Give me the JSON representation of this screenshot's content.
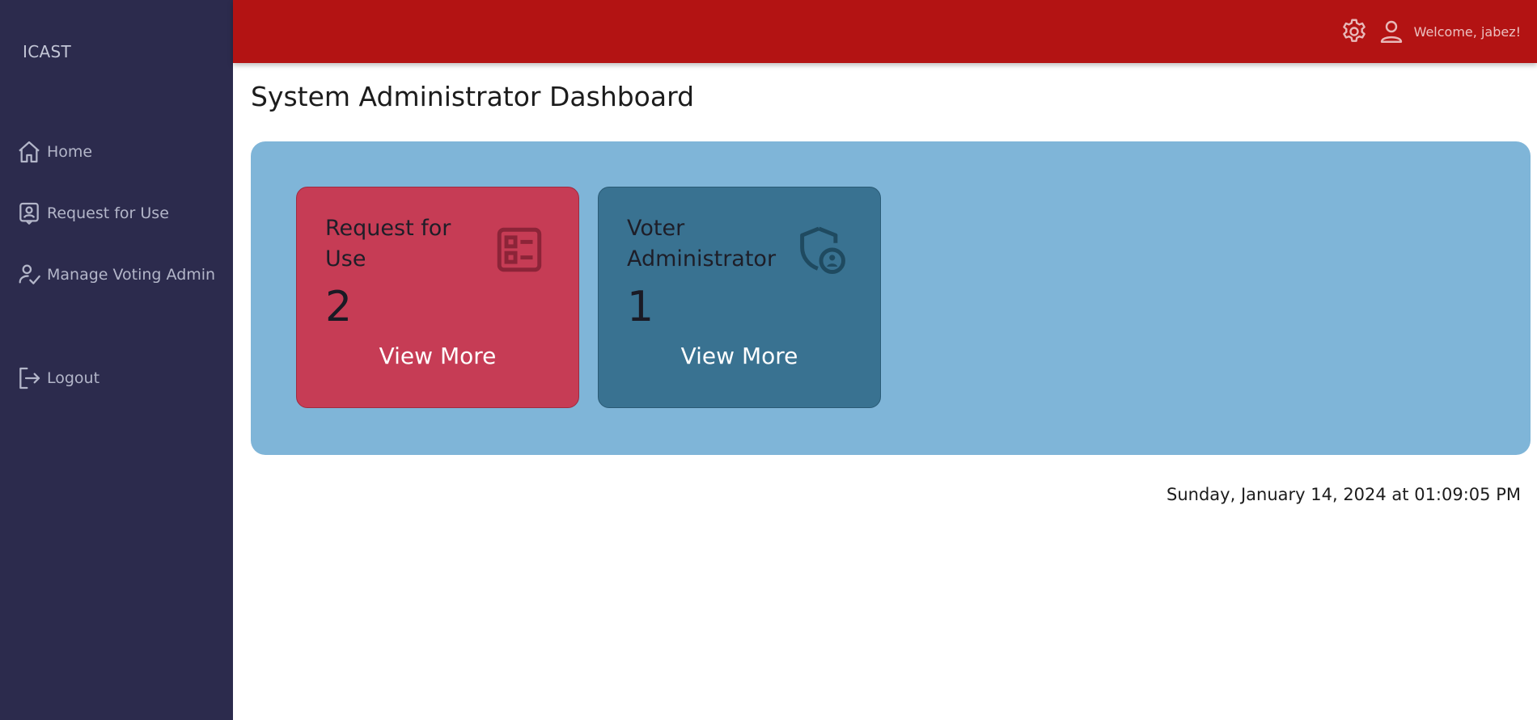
{
  "app": {
    "brand": "ICAST"
  },
  "sidebar": {
    "items": [
      {
        "label": "Home",
        "icon": "home-icon"
      },
      {
        "label": "Request for Use",
        "icon": "id-badge-icon"
      },
      {
        "label": "Manage Voting Admin",
        "icon": "user-check-icon"
      },
      {
        "label": "Logout",
        "icon": "logout-icon"
      }
    ]
  },
  "header": {
    "welcome": "Welcome, jabez!",
    "icons": [
      "gear-icon",
      "user-icon"
    ]
  },
  "main": {
    "title": "System Administrator Dashboard",
    "cards": [
      {
        "title": "Request for Use",
        "count": "2",
        "link": "View More",
        "icon": "checklist-icon",
        "color": "#c63c55"
      },
      {
        "title": "Voter Administrator",
        "count": "1",
        "link": "View More",
        "icon": "shield-user-icon",
        "color": "#397291"
      }
    ],
    "datetime": "Sunday, January 14, 2024 at 01:09:05 PM"
  },
  "colors": {
    "sidebar": "#2c2b4d",
    "topbar": "#b31313",
    "panel": "#7fb5d8"
  }
}
